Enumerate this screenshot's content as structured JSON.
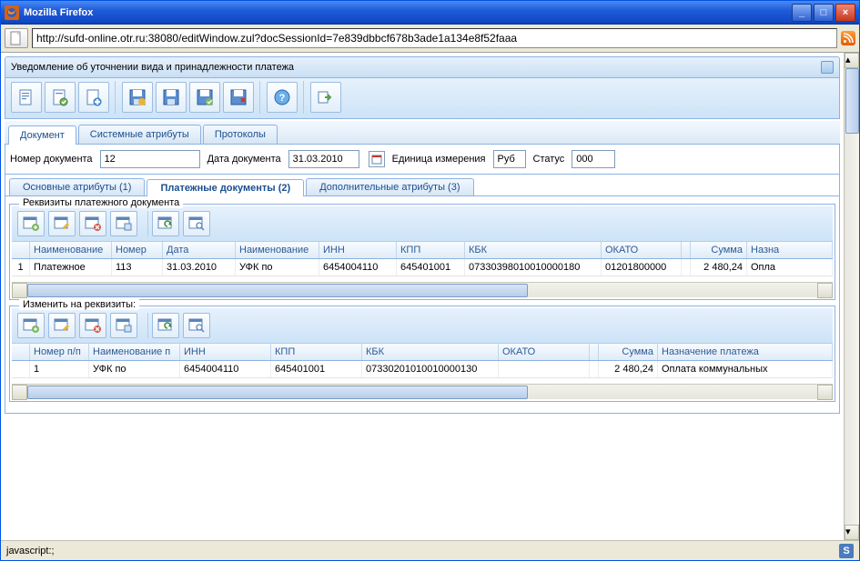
{
  "window": {
    "title": "Mozilla Firefox"
  },
  "browser": {
    "url": "http://sufd-online.otr.ru:38080/editWindow.zul?docSessionId=7e839dbbcf678b3ade1a134e8f52faaa"
  },
  "panel": {
    "title": "Уведомление об уточнении вида и принадлежности платежа"
  },
  "tabs": {
    "t1": "Документ",
    "t2": "Системные атрибуты",
    "t3": "Протоколы"
  },
  "form": {
    "docnum_label": "Номер документа",
    "docnum_val": "12",
    "date_label": "Дата документа",
    "date_val": "31.03.2010",
    "unit_label": "Единица измерения",
    "unit_val": "Руб",
    "status_label": "Статус",
    "status_val": "000"
  },
  "subtabs": {
    "s1": "Основные атрибуты (1)",
    "s2": "Платежные документы (2)",
    "s3": "Дополнительные атрибуты (3)"
  },
  "group1": {
    "legend": "Реквизиты платежного документа",
    "columns": {
      "c0": "",
      "c1": "Наименование",
      "c2": "Номер",
      "c3": "Дата",
      "c4": "Наименование",
      "c5": "ИНН",
      "c6": "КПП",
      "c7": "КБК",
      "c8": "ОКАТО",
      "c9": "Сумма",
      "c10": "Назна"
    },
    "row": {
      "n": "1",
      "name1": "Платежное",
      "num": "113",
      "date": "31.03.2010",
      "name2": "УФК по",
      "inn": "6454004110",
      "kpp": "645401001",
      "kbk": "07330398010010000180",
      "okato": "01201800000",
      "sum": "2 480,24",
      "purp": "Опла"
    }
  },
  "group2": {
    "legend": "Изменить на реквизиты:",
    "columns": {
      "c0": "",
      "c1": "Номер п/п",
      "c2": "Наименование п",
      "c3": "ИНН",
      "c4": "КПП",
      "c5": "КБК",
      "c6": "ОКАТО",
      "c7": "",
      "c8": "Сумма",
      "c9": "Назначение платежа"
    },
    "row": {
      "n": "1",
      "name": "УФК по",
      "inn": "6454004110",
      "kpp": "645401001",
      "kbk": "07330201010010000130",
      "okato": "",
      "empty": "",
      "sum": "2 480,24",
      "purp": "Оплата коммунальных"
    }
  },
  "status": {
    "text": "javascript:;"
  }
}
